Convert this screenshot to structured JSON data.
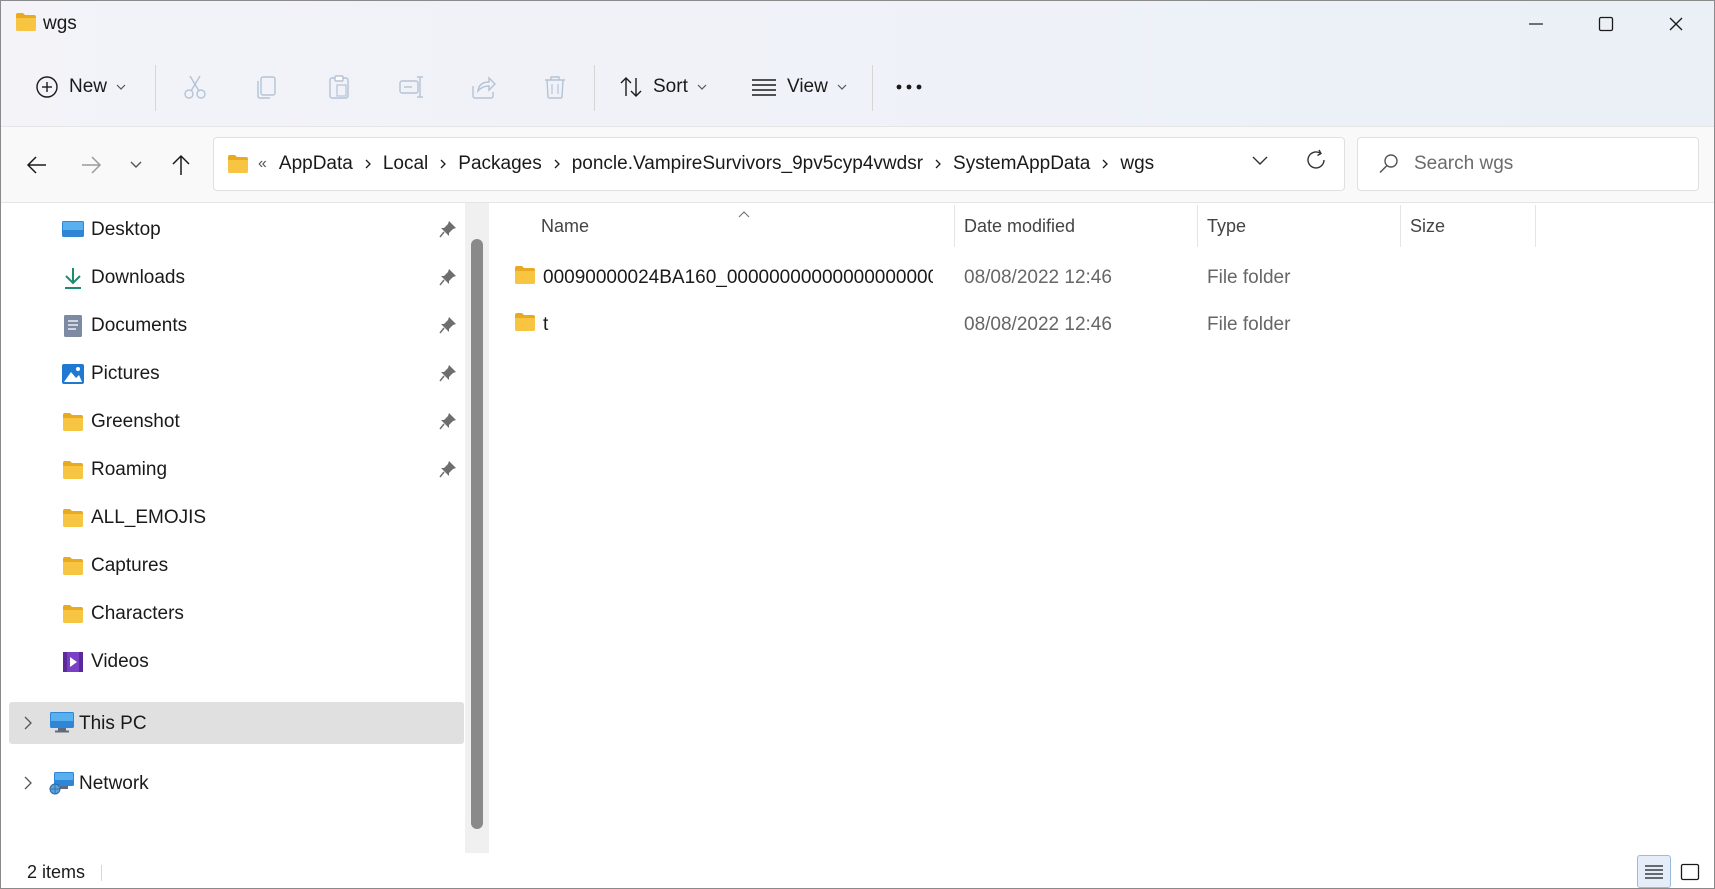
{
  "window": {
    "title": "wgs"
  },
  "commandbar": {
    "new_label": "New",
    "sort_label": "Sort",
    "view_label": "View"
  },
  "address": {
    "overflow": "«",
    "crumbs": [
      "AppData",
      "Local",
      "Packages",
      "poncle.VampireSurvivors_9pv5cyp4vwdsr",
      "SystemAppData",
      "wgs"
    ]
  },
  "search": {
    "placeholder": "Search wgs"
  },
  "navpane": {
    "quick_access": [
      {
        "label": "Desktop",
        "icon": "desktop-icon",
        "pinned": true
      },
      {
        "label": "Downloads",
        "icon": "downloads-icon",
        "pinned": true
      },
      {
        "label": "Documents",
        "icon": "documents-icon",
        "pinned": true
      },
      {
        "label": "Pictures",
        "icon": "pictures-icon",
        "pinned": true
      },
      {
        "label": "Greenshot",
        "icon": "folder-icon",
        "pinned": true
      },
      {
        "label": "Roaming",
        "icon": "folder-icon",
        "pinned": true
      },
      {
        "label": "ALL_EMOJIS",
        "icon": "folder-icon",
        "pinned": false
      },
      {
        "label": "Captures",
        "icon": "folder-icon",
        "pinned": false
      },
      {
        "label": "Characters",
        "icon": "folder-icon",
        "pinned": false
      },
      {
        "label": "Videos",
        "icon": "videos-icon",
        "pinned": false
      }
    ],
    "roots": [
      {
        "label": "This PC",
        "icon": "this-pc-icon",
        "selected": true
      },
      {
        "label": "Network",
        "icon": "network-icon",
        "selected": false
      }
    ]
  },
  "filelist": {
    "columns": [
      "Name",
      "Date modified",
      "Type",
      "Size"
    ],
    "rows": [
      {
        "name": "00090000024BA160_00000000000000000000...",
        "date": "08/08/2022 12:46",
        "type": "File folder",
        "size": ""
      },
      {
        "name": "t",
        "date": "08/08/2022 12:46",
        "type": "File folder",
        "size": ""
      }
    ]
  },
  "status": {
    "items_count": "2 items"
  },
  "colors": {
    "folder": "#f8c542",
    "folder_dark": "#e9a923",
    "accent": "#1e6fc8",
    "selected_bg": "#e0e0e0"
  }
}
